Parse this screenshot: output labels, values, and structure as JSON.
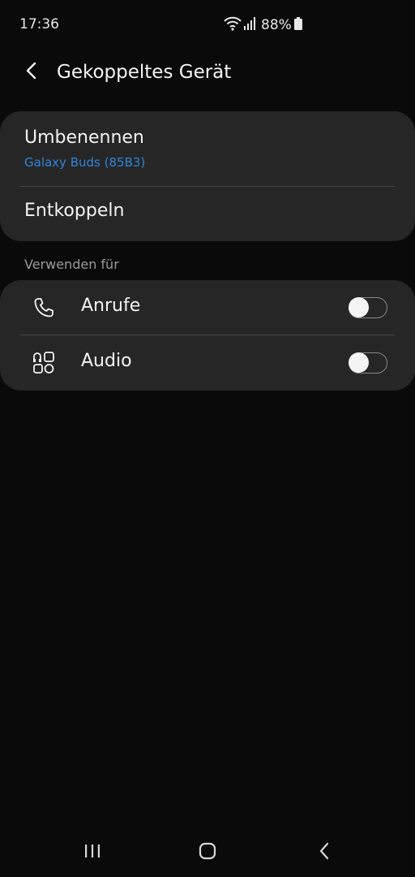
{
  "status_bar": {
    "time": "17:36",
    "battery_percent": "88%",
    "icons": [
      "wifi-icon",
      "signal-icon",
      "battery-icon"
    ]
  },
  "header": {
    "title": "Gekoppeltes Gerät",
    "back_icon": "back-arrow-icon"
  },
  "device_card": {
    "rename_label": "Umbenennen",
    "device_name": "Galaxy Buds (85B3)",
    "unpair_label": "Entkoppeln"
  },
  "use_for": {
    "section_title": "Verwenden für",
    "items": [
      {
        "label": "Anrufe",
        "icon": "phone-icon",
        "enabled": false
      },
      {
        "label": "Audio",
        "icon": "media-icon",
        "enabled": false
      }
    ]
  },
  "nav_bar": {
    "buttons": [
      "recent-apps-icon",
      "home-icon",
      "back-icon"
    ]
  },
  "colors": {
    "background": "#0a0a0a",
    "card": "#262626",
    "accent_link": "#2f86db",
    "section_header": "#9a9a9a"
  }
}
